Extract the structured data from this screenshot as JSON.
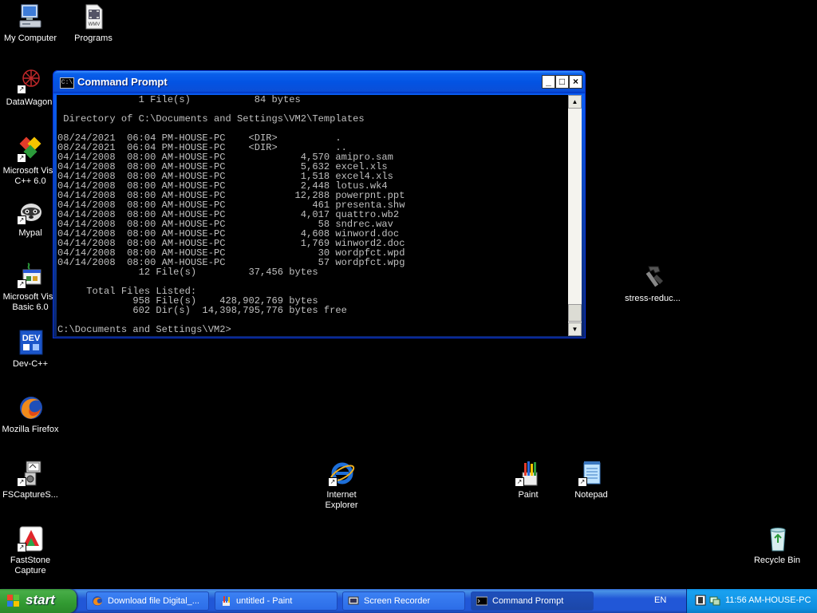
{
  "desktop": {
    "icons": [
      {
        "label": "My Computer"
      },
      {
        "label": "Programs"
      },
      {
        "label": "DataWagon."
      },
      {
        "label": "Microsoft Visu\nC++ 6.0"
      },
      {
        "label": "Mypal"
      },
      {
        "label": "Microsoft Visu\nBasic 6.0"
      },
      {
        "label": "Dev-C++"
      },
      {
        "label": "Mozilla Firefox"
      },
      {
        "label": "FSCaptureS..."
      },
      {
        "label": "FastStone\nCapture"
      },
      {
        "label": "stress-reduc..."
      },
      {
        "label": "Internet\nExplorer"
      },
      {
        "label": "Paint"
      },
      {
        "label": "Notepad"
      },
      {
        "label": "Recycle Bin"
      }
    ],
    "icon_text": {
      "programs_badge": "WMV",
      "devcpp_badge": "DEV"
    }
  },
  "cmd_window": {
    "title": "Command Prompt",
    "title_icon_text": "C:\\",
    "minimize": "_",
    "maximize": "□",
    "close": "×",
    "console_text": "              1 File(s)           84 bytes\n\n Directory of C:\\Documents and Settings\\VM2\\Templates\n\n08/24/2021  06:04 PM-HOUSE-PC    <DIR>          .\n08/24/2021  06:04 PM-HOUSE-PC    <DIR>          ..\n04/14/2008  08:00 AM-HOUSE-PC             4,570 amipro.sam\n04/14/2008  08:00 AM-HOUSE-PC             5,632 excel.xls\n04/14/2008  08:00 AM-HOUSE-PC             1,518 excel4.xls\n04/14/2008  08:00 AM-HOUSE-PC             2,448 lotus.wk4\n04/14/2008  08:00 AM-HOUSE-PC            12,288 powerpnt.ppt\n04/14/2008  08:00 AM-HOUSE-PC               461 presenta.shw\n04/14/2008  08:00 AM-HOUSE-PC             4,017 quattro.wb2\n04/14/2008  08:00 AM-HOUSE-PC                58 sndrec.wav\n04/14/2008  08:00 AM-HOUSE-PC             4,608 winword.doc\n04/14/2008  08:00 AM-HOUSE-PC             1,769 winword2.doc\n04/14/2008  08:00 AM-HOUSE-PC                30 wordpfct.wpd\n04/14/2008  08:00 AM-HOUSE-PC                57 wordpfct.wpg\n              12 File(s)         37,456 bytes\n\n     Total Files Listed:\n             958 File(s)    428,902,769 bytes\n             602 Dir(s)  14,398,795,776 bytes free\n\nC:\\Documents and Settings\\VM2>",
    "scroll_up": "▲",
    "scroll_down": "▼"
  },
  "taskbar": {
    "start_label": "start",
    "tasks": [
      {
        "label": "Download file Digital_..."
      },
      {
        "label": "untitled - Paint"
      },
      {
        "label": "Screen Recorder"
      },
      {
        "label": "Command Prompt"
      }
    ],
    "language": "EN",
    "clock": "11:56 AM-HOUSE-PC"
  },
  "colors": {
    "desktop_bg": "#000000",
    "console_bg": "#000000",
    "console_fg": "#c0c0c0",
    "titlebar": "#0353e3",
    "taskbar": "#2157d7",
    "start_green": "#319a31",
    "tray": "#0f8ee0"
  }
}
